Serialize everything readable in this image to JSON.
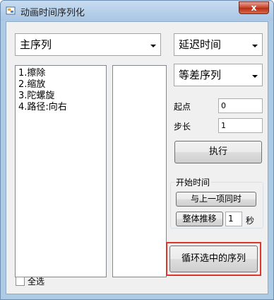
{
  "window": {
    "title": "动画时间序列化",
    "close_glyph": "x"
  },
  "main_combo": {
    "value": "主序列"
  },
  "delay_combo": {
    "value": "延迟时间"
  },
  "seq_combo": {
    "value": "等差序列"
  },
  "animation_list": {
    "items": [
      "1.擦除",
      "2.缩放",
      "3.陀螺旋",
      "4.路径:向右"
    ]
  },
  "start": {
    "label": "起点",
    "value": "0"
  },
  "step": {
    "label": "步长",
    "value": "1"
  },
  "execute_button": "执行",
  "start_time_group": {
    "legend": "开始时间",
    "with_previous_button": "与上一项同时",
    "shift_all_button": "整体推移",
    "shift_value": "1",
    "unit": "秒"
  },
  "loop_button": "循环选中的序列",
  "select_all": {
    "label": "全选",
    "checked": false
  },
  "colors": {
    "highlight": "#e0352b",
    "title_bar": "#aecbe6"
  }
}
